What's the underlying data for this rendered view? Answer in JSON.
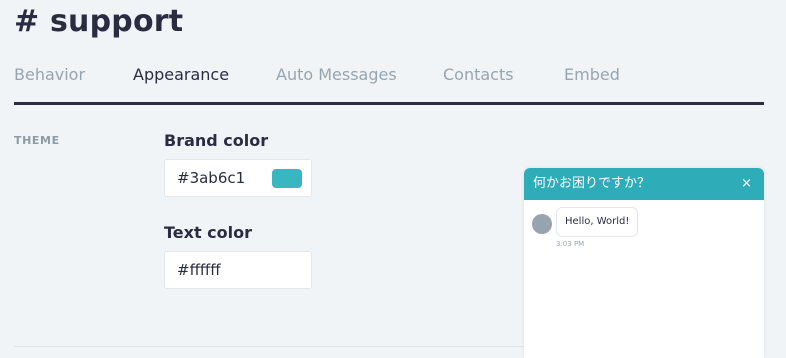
{
  "page": {
    "title": "# support"
  },
  "tabs": [
    {
      "label": "Behavior",
      "active": false
    },
    {
      "label": "Appearance",
      "active": true
    },
    {
      "label": "Auto Messages",
      "active": false
    },
    {
      "label": "Contacts",
      "active": false
    },
    {
      "label": "Embed",
      "active": false
    }
  ],
  "theme": {
    "section_label": "THEME",
    "brand_color": {
      "label": "Brand color",
      "value": "#3ab6c1",
      "swatch": "#3ab6c1"
    },
    "text_color": {
      "label": "Text color",
      "value": "#ffffff"
    }
  },
  "widget": {
    "title": "何かお困りですか？",
    "close_glyph": "×",
    "header_color": "#2eadb9",
    "message": {
      "text": "Hello, World!",
      "time": "3:03 PM"
    }
  },
  "colors": {
    "background": "#f0f4f6",
    "primary_text": "#2a2d42",
    "muted_text": "#97a5b1"
  }
}
